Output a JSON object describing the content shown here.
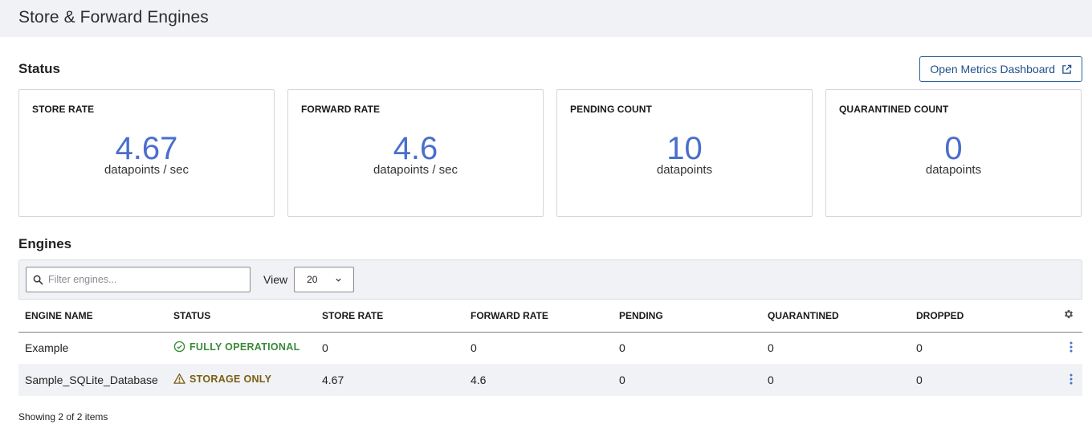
{
  "header": {
    "title": "Store & Forward Engines"
  },
  "status_section": {
    "title": "Status",
    "metrics_button": "Open Metrics Dashboard",
    "cards": [
      {
        "title": "STORE RATE",
        "value": "4.67",
        "unit": "datapoints / sec"
      },
      {
        "title": "FORWARD RATE",
        "value": "4.6",
        "unit": "datapoints / sec"
      },
      {
        "title": "PENDING COUNT",
        "value": "10",
        "unit": "datapoints"
      },
      {
        "title": "QUARANTINED COUNT",
        "value": "0",
        "unit": "datapoints"
      }
    ]
  },
  "engines_section": {
    "title": "Engines",
    "filter_placeholder": "Filter engines...",
    "view_label": "View",
    "view_value": "20",
    "columns": [
      "ENGINE NAME",
      "STATUS",
      "STORE RATE",
      "FORWARD RATE",
      "PENDING",
      "QUARANTINED",
      "DROPPED"
    ],
    "rows": [
      {
        "name": "Example",
        "status": "FULLY OPERATIONAL",
        "status_kind": "ok",
        "store_rate": "0",
        "forward_rate": "0",
        "pending": "0",
        "quarantined": "0",
        "dropped": "0"
      },
      {
        "name": "Sample_SQLite_Database",
        "status": "STORAGE ONLY",
        "status_kind": "warn",
        "store_rate": "4.67",
        "forward_rate": "4.6",
        "pending": "0",
        "quarantined": "0",
        "dropped": "0"
      }
    ],
    "footer": "Showing 2 of 2 items"
  },
  "colors": {
    "accent": "#4a6ecd",
    "button_border": "#2e5f98",
    "ok": "#3a8a3a",
    "warn": "#7a5e12"
  },
  "icons": [
    "external-link-icon",
    "search-icon",
    "chevron-down-icon",
    "gear-icon",
    "check-circle-icon",
    "warning-triangle-icon",
    "kebab-menu-icon"
  ]
}
